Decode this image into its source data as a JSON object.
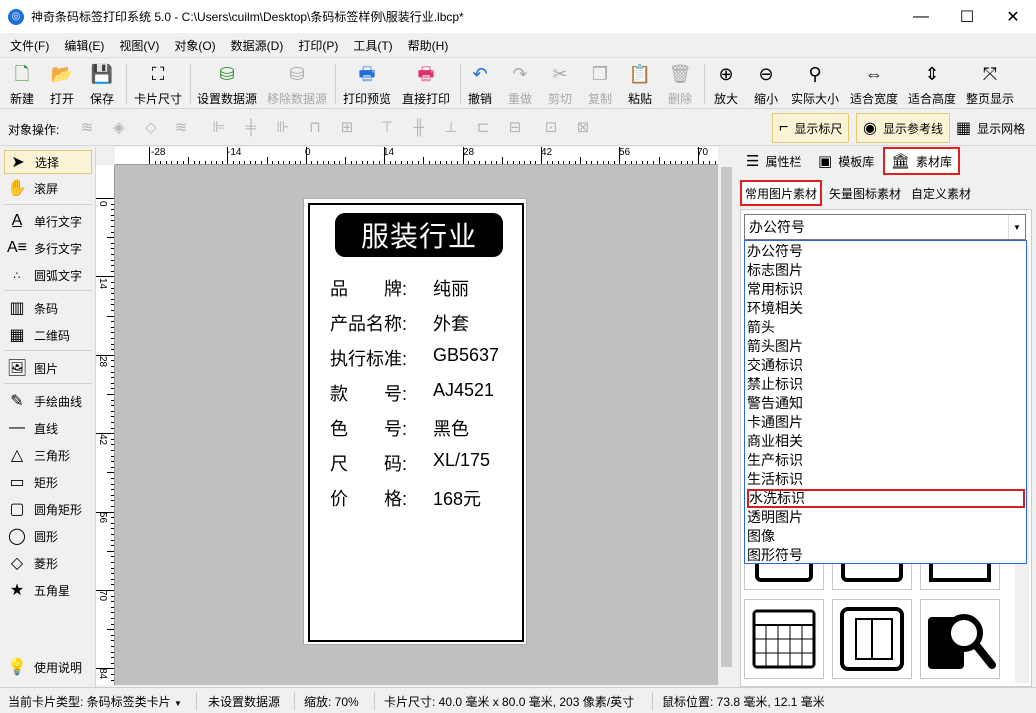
{
  "window": {
    "title": "神奇条码标签打印系统 5.0 - C:\\Users\\cuilm\\Desktop\\条码标签样例\\服装行业.lbcp*",
    "app_icon": "app-logo-icon"
  },
  "menu": [
    "文件(F)",
    "编辑(E)",
    "视图(V)",
    "对象(O)",
    "数据源(D)",
    "打印(P)",
    "工具(T)",
    "帮助(H)"
  ],
  "toolbar": {
    "new": "新建",
    "open": "打开",
    "save": "保存",
    "card_size": "卡片尺寸",
    "set_datasource": "设置数据源",
    "remove_datasource": "移除数据源",
    "print_preview": "打印预览",
    "direct_print": "直接打印",
    "undo": "撤销",
    "redo": "重做",
    "cut": "剪切",
    "copy": "复制",
    "paste": "粘贴",
    "delete": "删除",
    "zoom_in": "放大",
    "zoom_out": "缩小",
    "actual_size": "实际大小",
    "fit_width": "适合宽度",
    "fit_height": "适合高度",
    "fit_page": "整页显示"
  },
  "toolbar2": {
    "object_ops": "对象操作:",
    "show_ruler": "显示标尺",
    "show_guides": "显示参考线",
    "show_grid": "显示网格"
  },
  "tools": {
    "select": "选择",
    "scroll": "滚屏",
    "single_text": "单行文字",
    "multi_text": "多行文字",
    "arc_text": "圆弧文字",
    "barcode": "条码",
    "qrcode": "二维码",
    "image": "图片",
    "freehand": "手绘曲线",
    "line": "直线",
    "triangle": "三角形",
    "rectangle": "矩形",
    "rounded_rect": "圆角矩形",
    "ellipse": "圆形",
    "diamond": "菱形",
    "star": "五角星",
    "help": "使用说明"
  },
  "ruler": {
    "h_ticks": [
      "-28",
      "-14",
      "0",
      "14",
      "28",
      "42",
      "56",
      "70"
    ],
    "v_ticks": [
      "0",
      "14",
      "28",
      "42",
      "56",
      "70",
      "84"
    ]
  },
  "label": {
    "title": "服装行业",
    "rows": [
      {
        "key": "品　　牌:",
        "value": "纯丽"
      },
      {
        "key": "产品名称:",
        "value": "外套"
      },
      {
        "key": "执行标准:",
        "value": "GB5637"
      },
      {
        "key": "款　　号:",
        "value": "AJ4521"
      },
      {
        "key": "色　　号:",
        "value": "黑色"
      },
      {
        "key": "尺　　码:",
        "value": "XL/175"
      },
      {
        "key": "价　　格:",
        "value": "168元"
      }
    ]
  },
  "panel": {
    "tabs": [
      "属性栏",
      "模板库",
      "素材库"
    ],
    "subtabs": [
      "常用图片素材",
      "矢量图标素材",
      "自定义素材"
    ],
    "combo_value": "办公符号",
    "options": [
      "办公符号",
      "标志图片",
      "常用标识",
      "环境相关",
      "箭头",
      "箭头图片",
      "交通标识",
      "禁止标识",
      "警告通知",
      "卡通图片",
      "商业相关",
      "生产标识",
      "生活标识",
      "水洗标识",
      "透明图片",
      "图像",
      "图形符号"
    ],
    "highlighted_option": "水洗标识"
  },
  "status": {
    "card_type": "当前卡片类型: 条码标签类卡片",
    "datasource": "未设置数据源",
    "zoom": "缩放: 70%",
    "card_size": "卡片尺寸: 40.0 毫米 x 80.0 毫米, 203 像素/英寸",
    "mouse_pos": "鼠标位置: 73.8 毫米, 12.1 毫米"
  },
  "colors": {
    "highlight_border": "#e02020",
    "active_tool_bg": "#fbf3d5",
    "canvas_bg": "#c0c0c0",
    "dropdown_border": "#2a6bd3"
  }
}
